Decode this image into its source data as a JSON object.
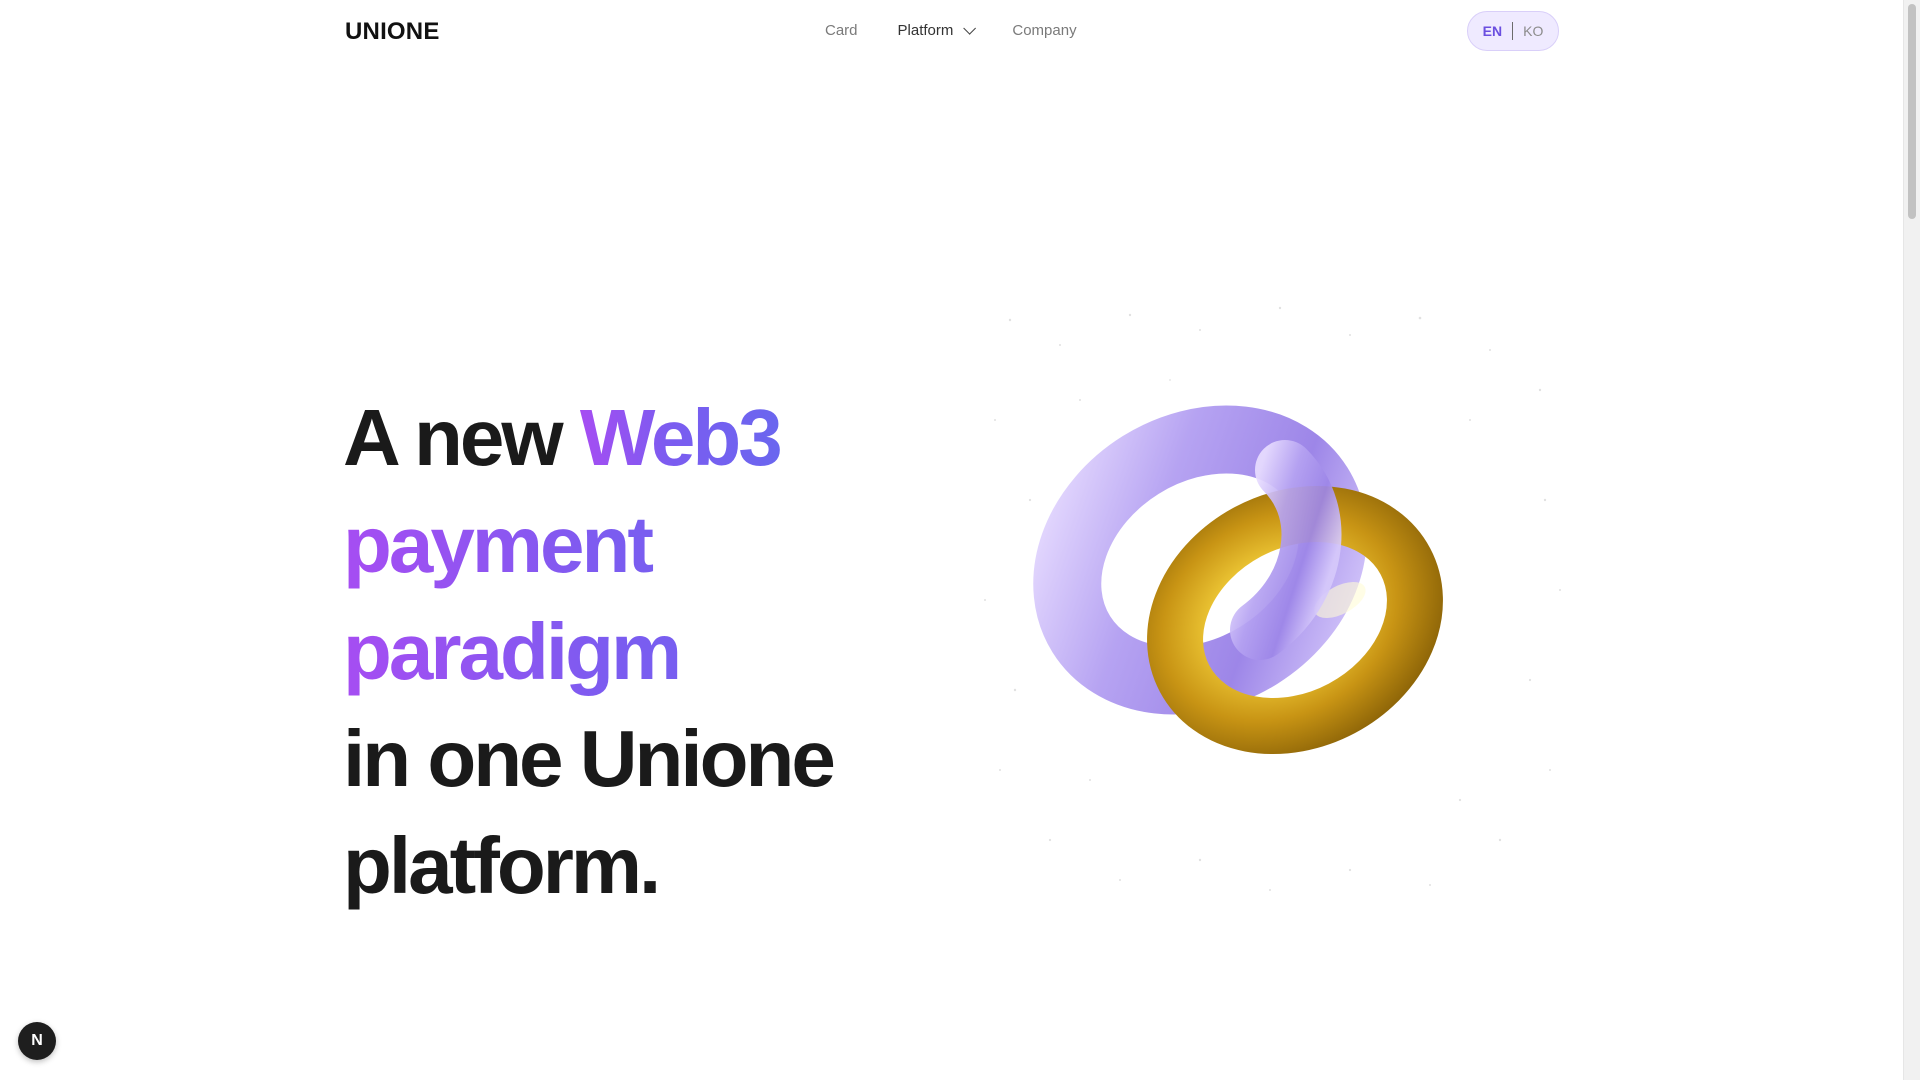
{
  "header": {
    "logo": "UNIONE",
    "nav": [
      {
        "label": "Card"
      },
      {
        "label": "Platform"
      },
      {
        "label": "Company"
      }
    ],
    "languages": {
      "en": "EN",
      "ko": "KO",
      "active": "EN"
    }
  },
  "hero": {
    "line1_plain": "A new",
    "line1_accent": "Web3",
    "line2": "payment",
    "line3": "paradigm",
    "line4": "in one Unione",
    "line5": "platform."
  },
  "badge": {
    "letter": "N"
  },
  "colors": {
    "accent_purple": "#a64df2",
    "accent_indigo": "#6a66ef",
    "lang_bg": "#efeaff",
    "ring_purple": "#b9a9f2",
    "ring_gold": "#e9c530"
  },
  "icons": {
    "dropdown": "chevron-down-icon",
    "rings": "interlocked-rings-icon",
    "next": "next-logo-icon"
  }
}
